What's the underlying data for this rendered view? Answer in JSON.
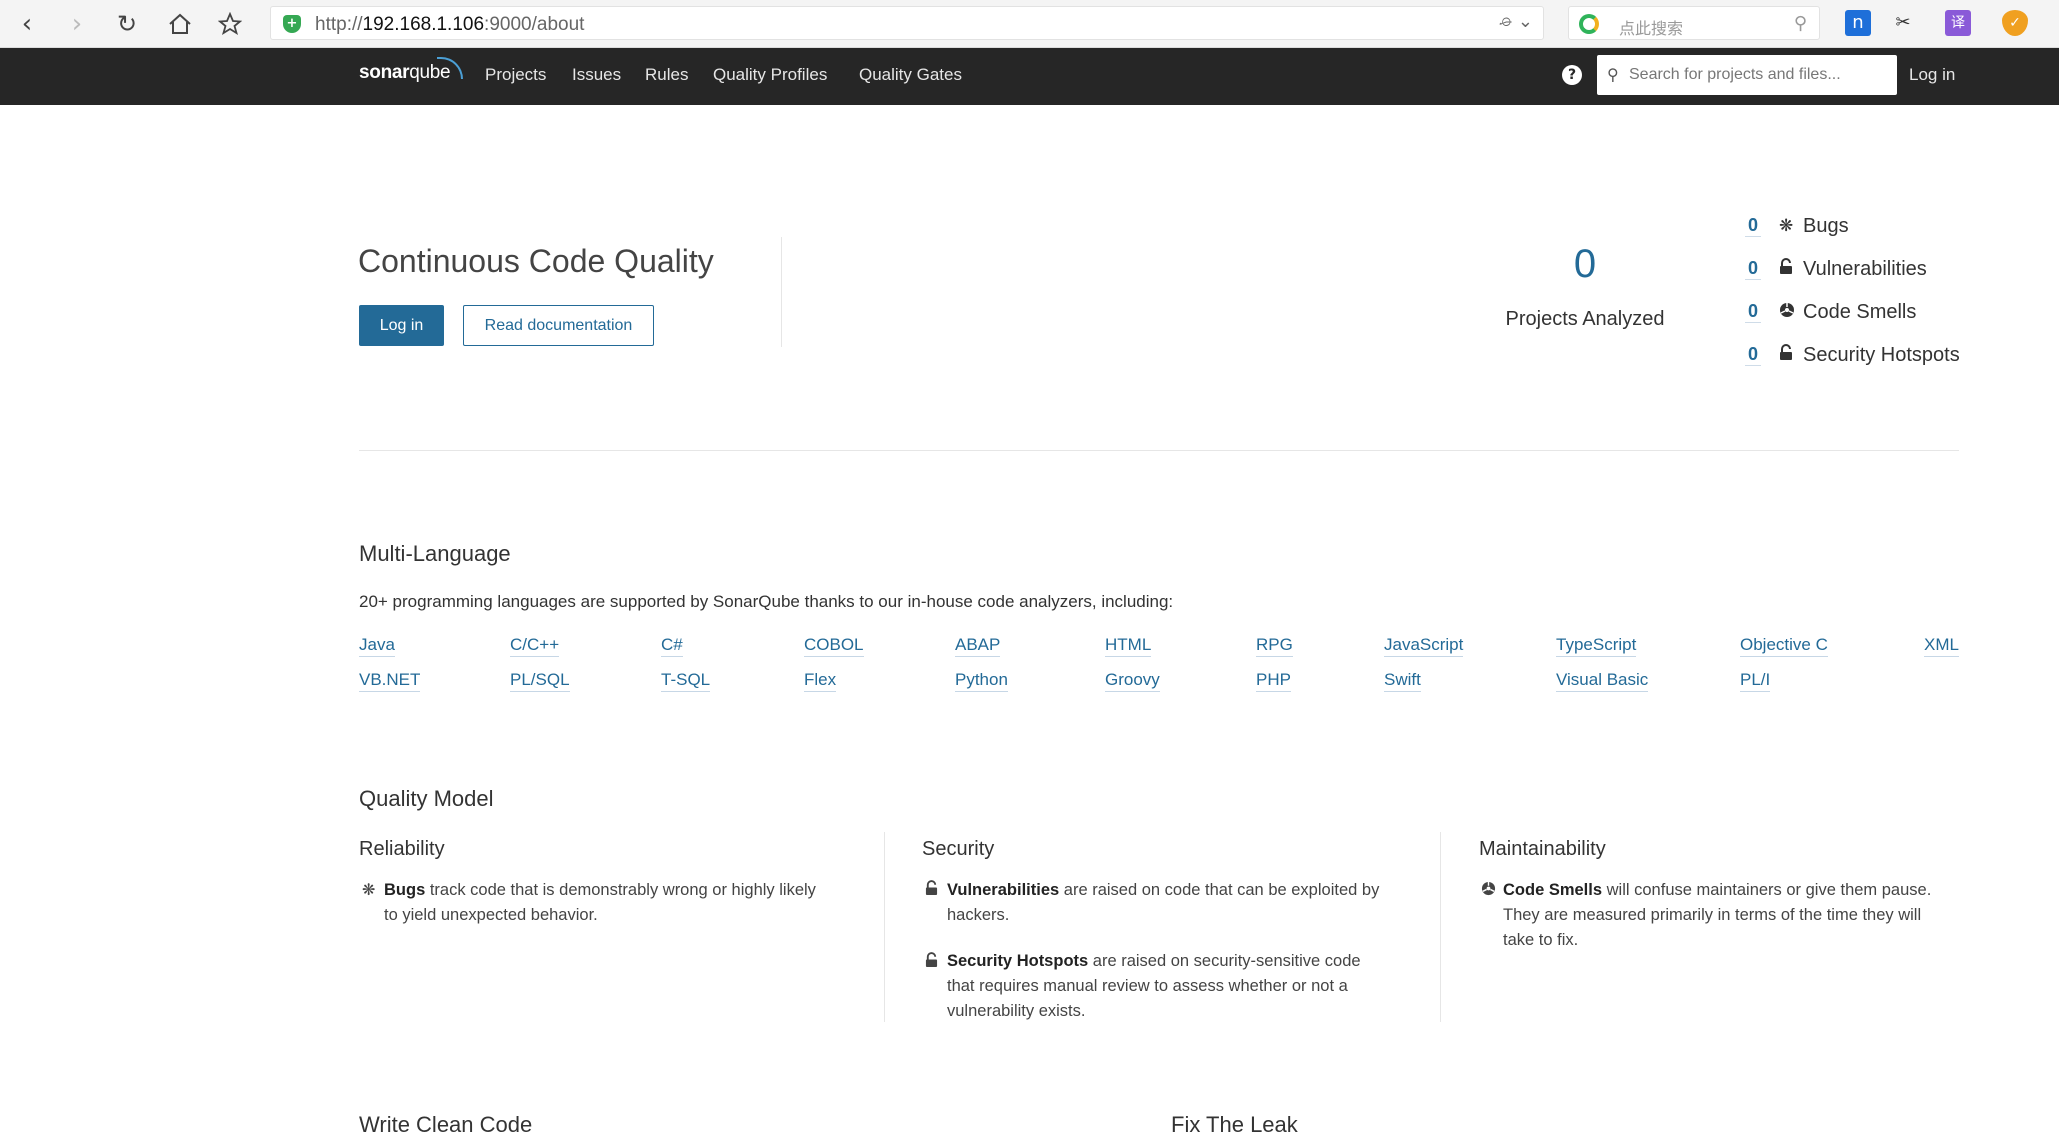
{
  "browser": {
    "url_scheme": "http://",
    "url_host": "192.168.1.106",
    "url_path": ":9000/about",
    "search_placeholder": "点此搜索"
  },
  "nav": {
    "logo_bold": "sonar",
    "logo_rest": "qube",
    "links": [
      "Projects",
      "Issues",
      "Rules",
      "Quality Profiles",
      "Quality Gates"
    ],
    "search_placeholder": "Search for projects and files...",
    "login": "Log in"
  },
  "hero": {
    "title": "Continuous Code Quality",
    "login_button": "Log in",
    "docs_button": "Read documentation",
    "projects_count": "0",
    "projects_label": "Projects Analyzed",
    "stats": [
      {
        "value": "0",
        "label": "Bugs",
        "icon": "bug-icon"
      },
      {
        "value": "0",
        "label": "Vulnerabilities",
        "icon": "lock-icon"
      },
      {
        "value": "0",
        "label": "Code Smells",
        "icon": "code-smell-icon"
      },
      {
        "value": "0",
        "label": "Security Hotspots",
        "icon": "lock-icon"
      }
    ]
  },
  "multi_language": {
    "title": "Multi-Language",
    "description": "20+ programming languages are supported by SonarQube thanks to our in-house code analyzers, including:",
    "languages": [
      "Java",
      "C/C++",
      "C#",
      "COBOL",
      "ABAP",
      "HTML",
      "RPG",
      "JavaScript",
      "TypeScript",
      "Objective C",
      "XML",
      "VB.NET",
      "PL/SQL",
      "T-SQL",
      "Flex",
      "Python",
      "Groovy",
      "PHP",
      "Swift",
      "Visual Basic",
      "PL/I"
    ]
  },
  "quality_model": {
    "title": "Quality Model",
    "reliability": {
      "title": "Reliability",
      "bugs_bold": "Bugs",
      "bugs_line1": " track code that is demonstrably wrong or highly likely",
      "bugs_line2": "to yield unexpected behavior."
    },
    "security": {
      "title": "Security",
      "vuln_bold": "Vulnerabilities",
      "vuln_line1": " are raised on code that can be exploited by",
      "vuln_line2": "hackers.",
      "hotspot_bold": "Security Hotspots",
      "hotspot_line1": " are raised on security-sensitive code",
      "hotspot_line2": "that requires manual review to assess whether or not a",
      "hotspot_line3": "vulnerability exists."
    },
    "maintainability": {
      "title": "Maintainability",
      "smell_bold": "Code Smells",
      "smell_line1": " will confuse maintainers or give them pause.",
      "smell_line2": "They are measured primarily in terms of the time they will",
      "smell_line3": "take to fix."
    }
  },
  "bottom_sections": {
    "write_clean_code": "Write Clean Code",
    "fix_the_leak": "Fix The Leak"
  }
}
